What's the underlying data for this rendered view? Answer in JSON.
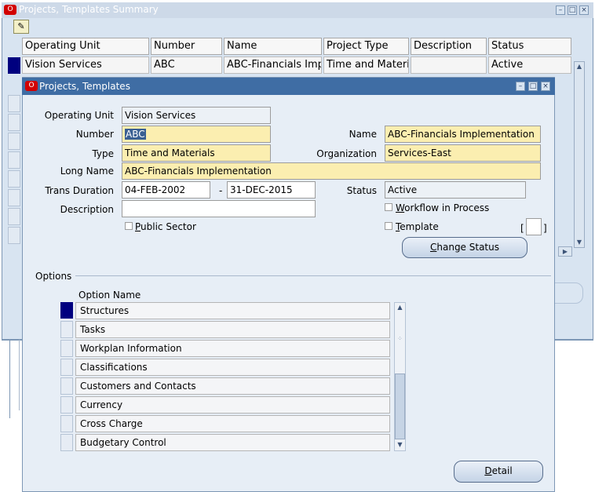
{
  "background_window": {
    "title": "Projects, Templates Summary",
    "columns": [
      "Operating Unit",
      "Number",
      "Name",
      "Project Type",
      "Description",
      "Status"
    ],
    "rows": [
      [
        "Vision Services",
        "ABC",
        "ABC-Financials Imple",
        "Time and Materials",
        "",
        "Active"
      ]
    ]
  },
  "front_window": {
    "title": "Projects, Templates",
    "fields": {
      "operating_unit_label": "Operating Unit",
      "operating_unit_value": "Vision Services",
      "number_label": "Number",
      "number_value": "ABC",
      "name_label": "Name",
      "name_value": "ABC-Financials Implementation",
      "type_label": "Type",
      "type_value": "Time and Materials",
      "organization_label": "Organization",
      "organization_value": "Services-East",
      "long_name_label": "Long Name",
      "long_name_value": "ABC-Financials Implementation",
      "trans_duration_label": "Trans Duration",
      "trans_start": "04-FEB-2002",
      "trans_dash": "-",
      "trans_end": "31-DEC-2015",
      "status_label": "Status",
      "status_value": "Active",
      "description_label": "Description",
      "description_value": ""
    },
    "checkboxes": {
      "public_sector_u": "P",
      "public_sector_rest": "ublic Sector",
      "workflow_u": "W",
      "workflow_rest": "orkflow in Process",
      "template_u": "T",
      "template_rest": "emplate"
    },
    "brackets": {
      "open": "[",
      "close": "]"
    },
    "change_status_button": {
      "u": "C",
      "rest": "hange Status"
    },
    "options_section_label": "Options",
    "option_name_header": "Option Name",
    "options": [
      "Structures",
      "Tasks",
      "Workplan Information",
      "Classifications",
      "Customers and Contacts",
      "Currency",
      "Cross Charge",
      "Budgetary Control"
    ],
    "detail_button": {
      "u": "D",
      "rest": "etail"
    }
  },
  "colors": {
    "required_field": "#fbeeb0",
    "title_bar_active": "#3f6da4",
    "selection": "#00007f"
  }
}
